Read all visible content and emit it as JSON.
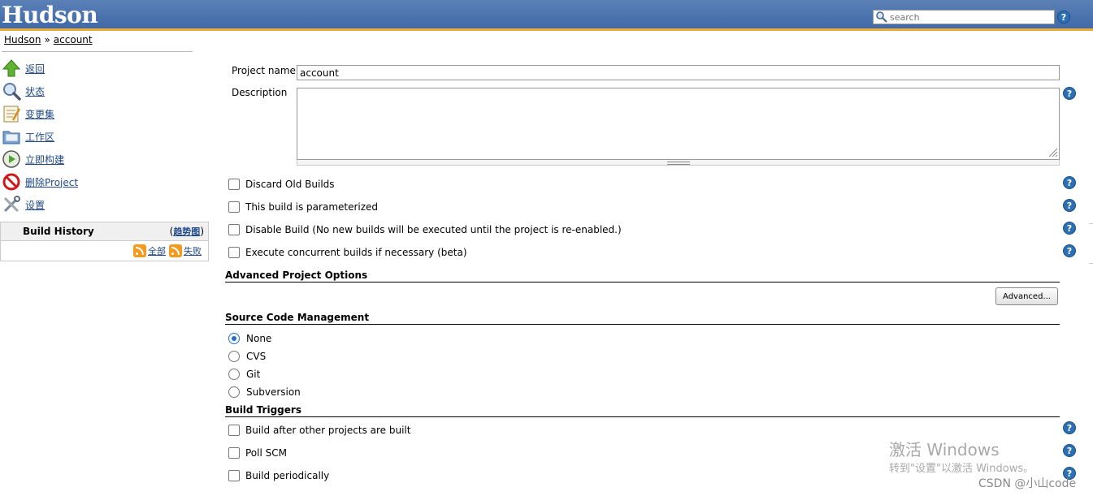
{
  "header": {
    "logo": "Hudson",
    "search_placeholder": "search",
    "help": "?"
  },
  "breadcrumb": {
    "root": "Hudson",
    "separator": "»",
    "current": "account"
  },
  "sidebar": {
    "tasks": [
      {
        "label": "返回",
        "icon": "up-arrow-icon"
      },
      {
        "label": "状态",
        "icon": "magnifier-icon"
      },
      {
        "label": "变更集",
        "icon": "notepad-icon"
      },
      {
        "label": "工作区",
        "icon": "folder-icon"
      },
      {
        "label": "立即构建",
        "icon": "build-clock-icon"
      },
      {
        "label": "删除Project",
        "icon": "no-entry-icon"
      },
      {
        "label": "设置",
        "icon": "tools-icon"
      }
    ],
    "build_history": {
      "title": "Build History",
      "trend_open": "(",
      "trend": "趋势图",
      "trend_close": ")",
      "feed_all": "全部",
      "feed_failed": "失败"
    }
  },
  "form": {
    "project_name_label": "Project name",
    "project_name_value": "account",
    "description_label": "Description",
    "options": [
      "Discard Old Builds",
      "This build is parameterized",
      "Disable Build (No new builds will be executed until the project is re-enabled.)",
      "Execute concurrent builds if necessary (beta)"
    ],
    "advanced_section": "Advanced Project Options",
    "advanced_button": "Advanced...",
    "scm_section": "Source Code Management",
    "scm_options": [
      {
        "label": "None",
        "checked": true
      },
      {
        "label": "CVS",
        "checked": false
      },
      {
        "label": "Git",
        "checked": false
      },
      {
        "label": "Subversion",
        "checked": false
      }
    ],
    "triggers_section": "Build Triggers",
    "triggers": [
      "Build after other projects are built",
      "Poll SCM",
      "Build periodically"
    ]
  },
  "overlay": {
    "activate_title": "激活 Windows",
    "activate_sub": "转到\"设置\"以激活 Windows。",
    "csdn": "CSDN @小山code"
  },
  "colors": {
    "header_blue": "#4a74b0",
    "header_accent": "#f0a73a",
    "link": "#204a87",
    "help_blue": "#2c6fb3"
  }
}
